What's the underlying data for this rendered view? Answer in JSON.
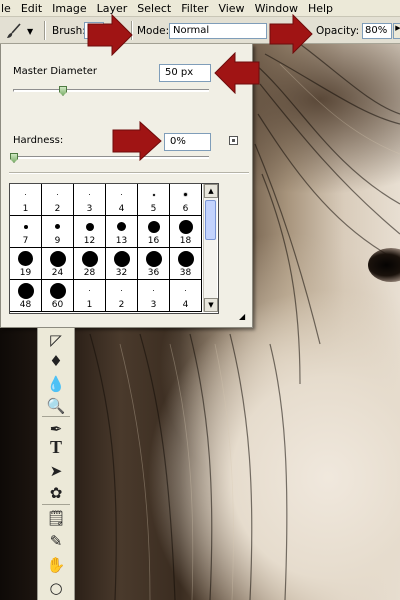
{
  "menubar": {
    "items": [
      "le",
      "Edit",
      "Image",
      "Layer",
      "Select",
      "Filter",
      "View",
      "Window",
      "Help"
    ]
  },
  "options_bar": {
    "tool_icon": "brush-icon",
    "brush_label": "Brush:",
    "mode_label": "Mode:",
    "mode_value": "Normal",
    "opacity_label": "Opacity:",
    "opacity_value": "80%"
  },
  "brush_panel": {
    "master_diameter_label": "Master Diameter",
    "master_diameter_value": "50 px",
    "master_diameter_slider_fraction": 0.25,
    "hardness_label": "Hardness:",
    "hardness_value": "0%",
    "hardness_slider_fraction": 0.0,
    "presets": [
      {
        "size": "1",
        "kind": "hard",
        "dot": 1
      },
      {
        "size": "2",
        "kind": "hard",
        "dot": 1
      },
      {
        "size": "3",
        "kind": "hard",
        "dot": 1
      },
      {
        "size": "4",
        "kind": "hard",
        "dot": 1
      },
      {
        "size": "5",
        "kind": "soft",
        "dot": 2
      },
      {
        "size": "6",
        "kind": "soft",
        "dot": 3
      },
      {
        "size": "7",
        "kind": "hard",
        "dot": 4
      },
      {
        "size": "9",
        "kind": "hard",
        "dot": 5
      },
      {
        "size": "12",
        "kind": "hard",
        "dot": 8
      },
      {
        "size": "13",
        "kind": "hard",
        "dot": 9
      },
      {
        "size": "16",
        "kind": "hard",
        "dot": 12
      },
      {
        "size": "18",
        "kind": "hard",
        "dot": 14
      },
      {
        "size": "19",
        "kind": "hard",
        "dot": 15
      },
      {
        "size": "24",
        "kind": "hard",
        "dot": 16
      },
      {
        "size": "28",
        "kind": "hard",
        "dot": 16
      },
      {
        "size": "32",
        "kind": "hard",
        "dot": 16
      },
      {
        "size": "36",
        "kind": "hard",
        "dot": 16
      },
      {
        "size": "38",
        "kind": "hard",
        "dot": 16
      },
      {
        "size": "48",
        "kind": "hard",
        "dot": 16
      },
      {
        "size": "60",
        "kind": "hard",
        "dot": 16
      },
      {
        "size": "1",
        "kind": "soft",
        "dot": 1
      },
      {
        "size": "2",
        "kind": "soft",
        "dot": 1
      },
      {
        "size": "3",
        "kind": "soft",
        "dot": 1
      },
      {
        "size": "4",
        "kind": "soft",
        "dot": 1
      }
    ]
  },
  "toolbox": {
    "tools": [
      {
        "name": "eraser-tool",
        "glyph": "◸"
      },
      {
        "name": "paint-bucket-tool",
        "glyph": "♦"
      },
      {
        "name": "blur-tool",
        "glyph": "💧"
      },
      {
        "name": "dodge-tool",
        "glyph": "🔍"
      },
      {
        "name": "pen-tool",
        "glyph": "✒"
      },
      {
        "name": "type-tool",
        "glyph": "T"
      },
      {
        "name": "path-selection-tool",
        "glyph": "➤"
      },
      {
        "name": "custom-shape-tool",
        "glyph": "✿"
      },
      {
        "name": "notes-tool",
        "glyph": "🗒"
      },
      {
        "name": "eyedropper-tool",
        "glyph": "✎"
      },
      {
        "name": "hand-tool",
        "glyph": "✋"
      },
      {
        "name": "zoom-tool",
        "glyph": "○"
      }
    ]
  },
  "annotations": {
    "arrow_color": "#a01414"
  }
}
